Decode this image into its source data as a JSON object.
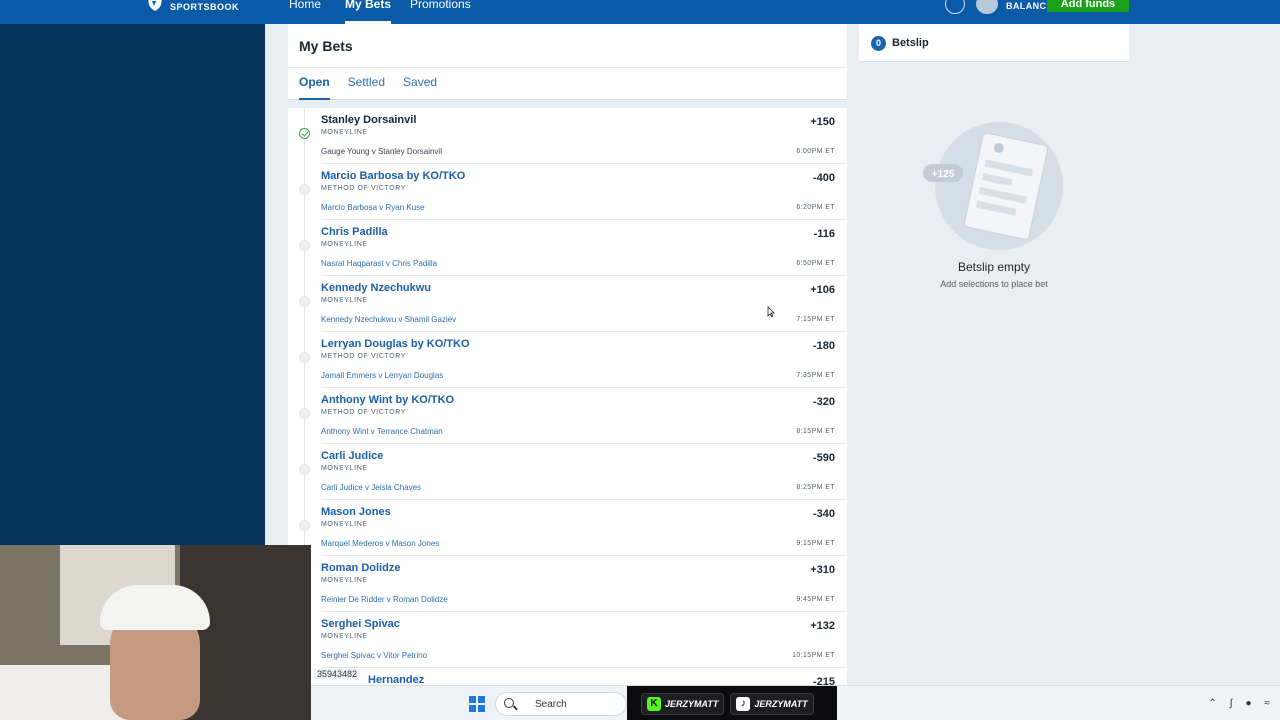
{
  "topnav": {
    "brand": "SPORTSBOOK",
    "links": [
      {
        "label": "Home",
        "active": false
      },
      {
        "label": "My Bets",
        "active": true
      },
      {
        "label": "Promotions",
        "active": false
      }
    ],
    "balance_label": "BALANCE",
    "add_funds": "Add funds"
  },
  "main": {
    "title": "My Bets",
    "tabs": [
      {
        "label": "Open",
        "active": true
      },
      {
        "label": "Settled",
        "active": false
      },
      {
        "label": "Saved",
        "active": false
      }
    ],
    "bets": [
      {
        "selection": "Stanley Dorsainvil",
        "market": "MONEYLINE",
        "event": "Gauge Young v Stanley Dorsainvil",
        "odds": "+150",
        "time": "6:00PM ET",
        "settled": true
      },
      {
        "selection": "Marcio Barbosa by KO/TKO",
        "market": "METHOD OF VICTORY",
        "event": "Marcio Barbosa v Ryan Kuse",
        "odds": "-400",
        "time": "6:20PM ET",
        "settled": false
      },
      {
        "selection": "Chris Padilla",
        "market": "MONEYLINE",
        "event": "Nasrat Haqparast v Chris Padilla",
        "odds": "-116",
        "time": "6:50PM ET",
        "settled": false
      },
      {
        "selection": "Kennedy Nzechukwu",
        "market": "MONEYLINE",
        "event": "Kennedy Nzechukwu v Shamil Gaziev",
        "odds": "+106",
        "time": "7:15PM ET",
        "settled": false
      },
      {
        "selection": "Lerryan Douglas by KO/TKO",
        "market": "METHOD OF VICTORY",
        "event": "Jamall Emmers v Lerryan Douglas",
        "odds": "-180",
        "time": "7:35PM ET",
        "settled": false
      },
      {
        "selection": "Anthony Wint by KO/TKO",
        "market": "METHOD OF VICTORY",
        "event": "Anthony Wint v Terrance Chatman",
        "odds": "-320",
        "time": "8:15PM ET",
        "settled": false
      },
      {
        "selection": "Carli Judice",
        "market": "MONEYLINE",
        "event": "Carli Judice v Jeisla Chaves",
        "odds": "-590",
        "time": "8:25PM ET",
        "settled": false
      },
      {
        "selection": "Mason Jones",
        "market": "MONEYLINE",
        "event": "Marquel Mederos v Mason Jones",
        "odds": "-340",
        "time": "9:15PM ET",
        "settled": false
      },
      {
        "selection": "Roman Dolidze",
        "market": "MONEYLINE",
        "event": "Reinier De Ridder v Roman Dolidze",
        "odds": "+310",
        "time": "9:45PM ET",
        "settled": false
      },
      {
        "selection": "Serghei Spivac",
        "market": "MONEYLINE",
        "event": "Serghei Spivac v Vitor Petrino",
        "odds": "+132",
        "time": "10:15PM ET",
        "settled": false
      },
      {
        "selection": "Hernandez",
        "market": "",
        "event": "",
        "odds": "-215",
        "time": "",
        "settled": false
      }
    ]
  },
  "betslip": {
    "count": "0",
    "title": "Betslip",
    "illustration_odds": "+125",
    "empty_title": "Betslip empty",
    "empty_sub": "Add selections to place bet"
  },
  "overlay": {
    "id_text": "35943482"
  },
  "taskbar": {
    "search_label": "Search",
    "social": [
      {
        "icon": "K",
        "name": "JERZYMATT"
      },
      {
        "icon": "♪",
        "name": "JERZYMATT"
      }
    ]
  }
}
